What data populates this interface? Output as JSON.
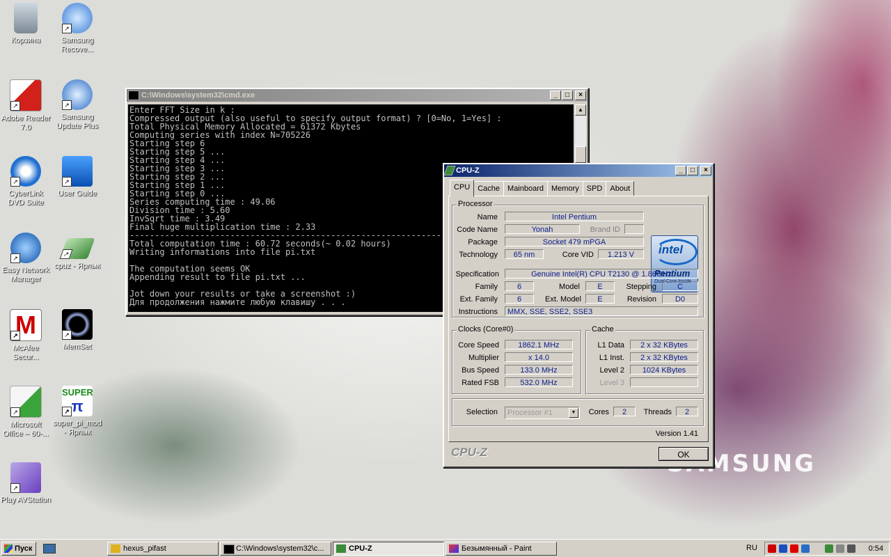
{
  "desktop": {
    "icons": [
      {
        "label": "Корзина",
        "icon": "recycle-bin-icon"
      },
      {
        "label": "Samsung Recove...",
        "icon": "samsung-recovery-icon"
      },
      {
        "label": "Adobe Reader 7.0",
        "icon": "adobe-reader-icon"
      },
      {
        "label": "Samsung Update Plus",
        "icon": "samsung-update-icon"
      },
      {
        "label": "CyberLink DVD Suite",
        "icon": "cyberlink-icon"
      },
      {
        "label": "User Guide",
        "icon": "user-guide-icon"
      },
      {
        "label": "Easy Network Manager",
        "icon": "network-manager-icon"
      },
      {
        "label": "cpuz - Ярлык",
        "icon": "cpuz-shortcut-icon"
      },
      {
        "label": "McAfee Secur...",
        "icon": "mcafee-icon"
      },
      {
        "label": "MemSet",
        "icon": "memset-icon"
      },
      {
        "label": "Microsoft Office – 60-...",
        "icon": "ms-office-icon"
      },
      {
        "label": "super_pi_mod - Ярлык",
        "icon": "superpi-icon"
      },
      {
        "label": "Play AVStation",
        "icon": "avstation-icon"
      }
    ],
    "wallpaper_logo": "SAMSUNG"
  },
  "cmd": {
    "title": "C:\\Windows\\system32\\cmd.exe",
    "lines": [
      "Enter FFT Size in k :",
      "Compressed output (also useful to specify output format) ? [0=No, 1=Yes] :",
      "Total Physical Memory Allocated = 61372 Kbytes",
      "Computing series with index N=705226",
      "Starting step 6",
      "Starting step 5 ...",
      "Starting step 4 ...",
      "Starting step 3 ...",
      "Starting step 2 ...",
      "Starting step 1 ...",
      "Starting step 0 ...",
      "Series computing time : 49.06",
      "Division time : 5.60",
      "InvSqrt time : 3.49",
      "Final huge multiplication time : 2.33",
      "------------------------------------------------------------------------------",
      "Total computation time : 60.72 seconds(~ 0.02 hours)",
      "Writing informations into file pi.txt",
      "",
      "The computation seems OK",
      "Appending result to file pi.txt ...",
      "",
      "Jot down your results or take a screenshot :)",
      "Для продолжения нажмите любую клавишу . . ."
    ]
  },
  "cpuz": {
    "title": "CPU-Z",
    "tabs": [
      "CPU",
      "Cache",
      "Mainboard",
      "Memory",
      "SPD",
      "About"
    ],
    "processor": {
      "group": "Processor",
      "name_label": "Name",
      "name": "Intel Pentium",
      "codename_label": "Code Name",
      "codename": "Yonah",
      "brandid_label": "Brand ID",
      "brandid": "",
      "package_label": "Package",
      "package": "Socket 479 mPGA",
      "technology_label": "Technology",
      "technology": "65 nm",
      "corevid_label": "Core VID",
      "corevid": "1.213 V",
      "spec_label": "Specification",
      "spec": "Genuine Intel(R) CPU          T2130  @ 1.86GHz",
      "family_label": "Family",
      "family": "6",
      "model_label": "Model",
      "model": "E",
      "stepping_label": "Stepping",
      "stepping": "C",
      "extfamily_label": "Ext. Family",
      "extfamily": "6",
      "extmodel_label": "Ext. Model",
      "extmodel": "E",
      "revision_label": "Revision",
      "revision": "D0",
      "instructions_label": "Instructions",
      "instructions": "MMX, SSE, SSE2, SSE3"
    },
    "logo": {
      "brand": "intel",
      "product": "Pentium",
      "sub": "Dual-Core Inside"
    },
    "clocks": {
      "group": "Clocks (Core#0)",
      "corespeed_label": "Core Speed",
      "corespeed": "1862.1 MHz",
      "multiplier_label": "Multiplier",
      "multiplier": "x 14.0",
      "busspeed_label": "Bus Speed",
      "busspeed": "133.0 MHz",
      "ratedfsb_label": "Rated FSB",
      "ratedfsb": "532.0 MHz"
    },
    "cache": {
      "group": "Cache",
      "l1data_label": "L1 Data",
      "l1data": "2 x 32 KBytes",
      "l1inst_label": "L1 Inst.",
      "l1inst": "2 x 32 KBytes",
      "level2_label": "Level 2",
      "level2": "1024 KBytes",
      "level3_label": "Level 3",
      "level3": ""
    },
    "selection": {
      "selection_label": "Selection",
      "selection": "Processor #1",
      "cores_label": "Cores",
      "cores": "2",
      "threads_label": "Threads",
      "threads": "2"
    },
    "version": "Version 1.41",
    "brand_text": "CPU-Z",
    "ok_label": "OK"
  },
  "taskbar": {
    "start_label": "Пуск",
    "tasks": [
      {
        "label": "hexus_pifast",
        "active": false
      },
      {
        "label": "C:\\Windows\\system32\\c...",
        "active": false
      },
      {
        "label": "CPU-Z",
        "active": true
      },
      {
        "label": "Безымянный - Paint",
        "active": false
      }
    ],
    "language": "RU",
    "clock": "0:54"
  }
}
